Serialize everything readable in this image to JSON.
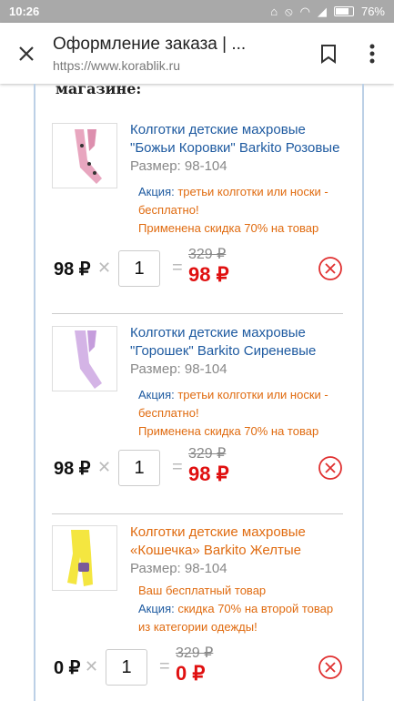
{
  "status": {
    "time": "10:26",
    "battery": "76%"
  },
  "toolbar": {
    "title": "Оформление заказа | ...",
    "url": "https://www.korablik.ru"
  },
  "section": {
    "title": "магазине:"
  },
  "items": [
    {
      "name": "Колготки детские махровые \"Божьи Коровки\" Barkito Розовые",
      "size": "Размер: 98-104",
      "promo": [
        {
          "label": "Акция: ",
          "text": "третьи колготки или носки - бесплатно!"
        },
        {
          "label": "",
          "text": "Применена скидка 70% на товар"
        }
      ],
      "unit_price": "98 ₽",
      "quantity": "1",
      "old_price": "329 ₽",
      "new_price": "98 ₽",
      "thumb_color": "#e8a6bf"
    },
    {
      "name": "Колготки детские махровые \"Горошек\" Barkito Сиреневые",
      "size": "Размер: 98-104",
      "promo": [
        {
          "label": "Акция: ",
          "text": "третьи колготки или носки - бесплатно!"
        },
        {
          "label": "",
          "text": "Применена скидка 70% на товар"
        }
      ],
      "unit_price": "98 ₽",
      "quantity": "1",
      "old_price": "329 ₽",
      "new_price": "98 ₽",
      "thumb_color": "#d4b4e6"
    },
    {
      "name": "Колготки детские махровые «Кошечка» Barkito Желтые",
      "size": "Размер: 98-104",
      "promo": [
        {
          "label": "",
          "text": "Ваш бесплатный товар"
        },
        {
          "label": "Акция: ",
          "text": "скидка 70% на второй товар из категории одежды!"
        }
      ],
      "unit_price": "0 ₽",
      "quantity": "1",
      "old_price": "329 ₽",
      "new_price": "0 ₽",
      "thumb_color": "#f4e640"
    }
  ],
  "icons": {
    "close": "close-icon",
    "bookmark": "bookmark-icon",
    "menu": "more-vert-icon",
    "remove": "remove-circle-icon"
  },
  "colors": {
    "link_blue": "#1e5aa0",
    "promo_orange": "#e06b10",
    "price_red": "#e01010"
  }
}
